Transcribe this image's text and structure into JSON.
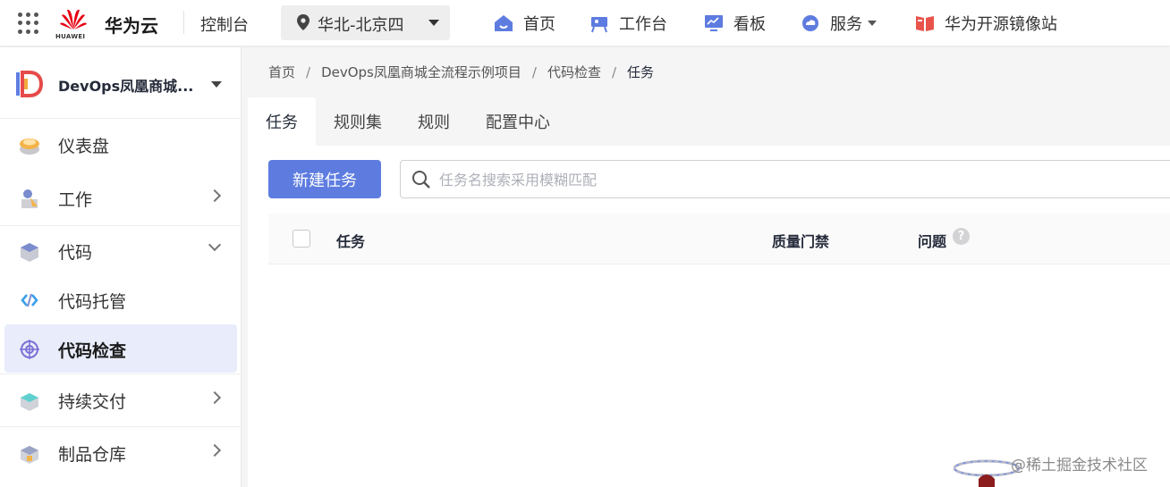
{
  "topbar": {
    "logo_text": "HUAWEI",
    "brand": "华为云",
    "console": "控制台",
    "region": "华北-北京四",
    "nav": [
      {
        "label": "首页",
        "icon": "home-icon"
      },
      {
        "label": "工作台",
        "icon": "workbench-icon"
      },
      {
        "label": "看板",
        "icon": "dashboard-board-icon"
      },
      {
        "label": "服务",
        "icon": "cloud-service-icon"
      },
      {
        "label": "华为开源镜像站",
        "icon": "mirror-book-icon"
      }
    ]
  },
  "sidebar": {
    "project_name": "DevOps凤凰商城...",
    "items": [
      {
        "label": "仪表盘",
        "icon": "dashboard-icon"
      },
      {
        "label": "工作",
        "icon": "work-icon"
      },
      {
        "label": "代码",
        "icon": "code-icon"
      },
      {
        "label": "代码托管",
        "icon": "code-hosting-icon"
      },
      {
        "label": "代码检查",
        "icon": "code-check-icon"
      },
      {
        "label": "持续交付",
        "icon": "continuous-delivery-icon"
      },
      {
        "label": "制品仓库",
        "icon": "artifact-repo-icon"
      }
    ]
  },
  "breadcrumb": [
    "首页",
    "DevOps凤凰商城全流程示例项目",
    "代码检查",
    "任务"
  ],
  "tabs": [
    "任务",
    "规则集",
    "规则",
    "配置中心"
  ],
  "toolbar": {
    "new_task_label": "新建任务",
    "search_placeholder": "任务名搜索采用模糊匹配"
  },
  "table": {
    "columns": [
      "任务",
      "质量门禁",
      "问题"
    ],
    "help_glyph": "?"
  },
  "watermark": "@稀土掘金技术社区",
  "colors": {
    "primary": "#5e7ce0",
    "active_menu_bg": "#e9ecfa",
    "huawei_red": "#e60012"
  }
}
